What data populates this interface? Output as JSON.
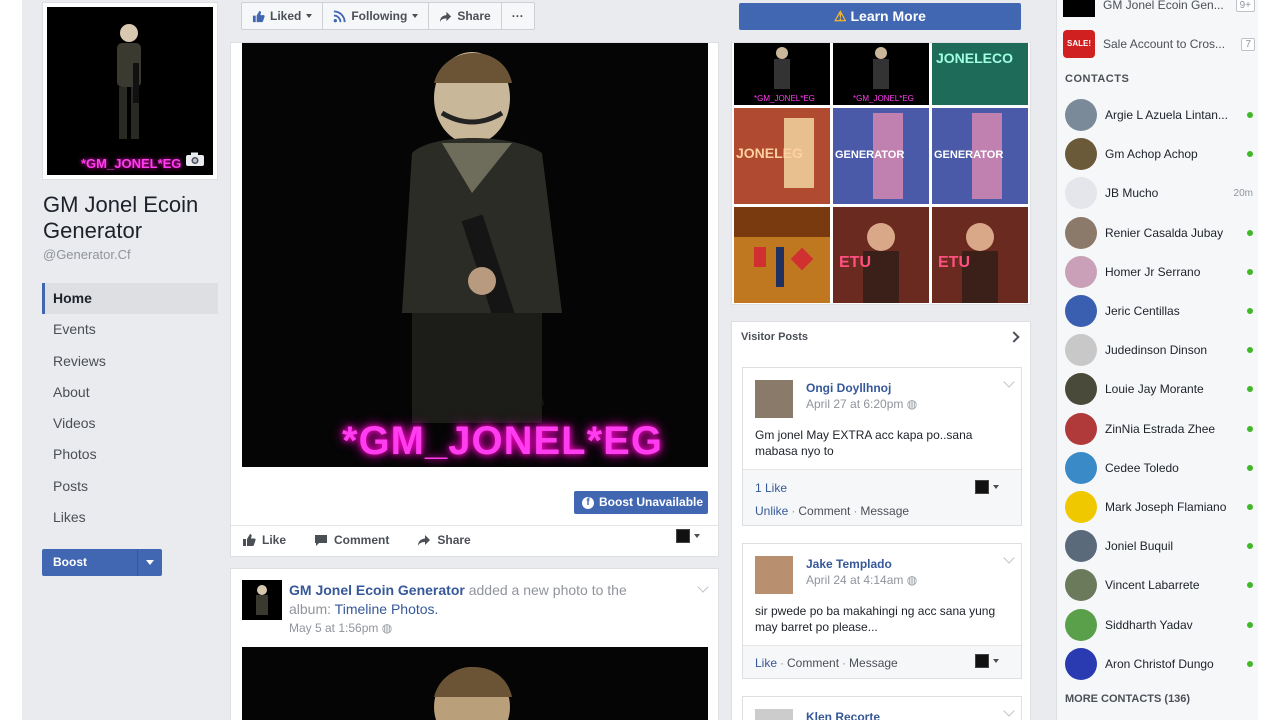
{
  "page": {
    "name": "GM Jonel Ecoin Generator",
    "handle": "@Generator.Cf",
    "profile_caption": "*GM_JONEL*EG"
  },
  "nav": [
    {
      "label": "Home"
    },
    {
      "label": "Events"
    },
    {
      "label": "Reviews"
    },
    {
      "label": "About"
    },
    {
      "label": "Videos"
    },
    {
      "label": "Photos"
    },
    {
      "label": "Posts"
    },
    {
      "label": "Likes"
    }
  ],
  "boost_label": "Boost",
  "action_bar": {
    "liked": "Liked",
    "following": "Following",
    "share": "Share",
    "more": "···"
  },
  "learn_more": "Learn More",
  "post1": {
    "image_caption": "*GM_JONEL*EG",
    "boost_unavailable": "Boost Unavailable",
    "like": "Like",
    "comment": "Comment",
    "share": "Share"
  },
  "post2": {
    "author": "GM Jonel Ecoin Generator",
    "action": "added a new photo to the album:",
    "album": "Timeline Photos.",
    "time": "May 5 at 1:56pm"
  },
  "photo_tiles": [
    {
      "label": ""
    },
    {
      "label": "*GM_JONEL*EG"
    },
    {
      "label": "JONELECO"
    },
    {
      "label": "JONELEG"
    },
    {
      "label": "GENERATOR"
    },
    {
      "label": "GENERATOR"
    },
    {
      "label": ""
    },
    {
      "label": "ETU"
    },
    {
      "label": "ETU"
    }
  ],
  "visitor_posts": {
    "title": "Visitor Posts",
    "items": [
      {
        "name": "Ongi Doyllhnoj",
        "time": "April 27 at 6:20pm",
        "text": "Gm jonel May EXTRA acc kapa po..sana mabasa nyo to",
        "likes": "1 Like",
        "link1": "Unlike",
        "link2": "Comment",
        "link3": "Message"
      },
      {
        "name": "Jake Templado",
        "time": "April 24 at 4:14am",
        "text": "sir pwede po ba makahingi ng acc sana yung may barret po please...",
        "link1": "Like",
        "link2": "Comment",
        "link3": "Message"
      },
      {
        "name": "Klen Recorte"
      }
    ]
  },
  "chat": {
    "top_items": [
      {
        "label": "GM Jonel Ecoin Gen...",
        "badge": "9+"
      },
      {
        "label": "Sale Account to Cros...",
        "badge": "7"
      }
    ],
    "contacts_heading": "CONTACTS",
    "contacts": [
      {
        "name": "Argie L Azuela Lintan...",
        "status": "online",
        "color": "#7a8a99"
      },
      {
        "name": "Gm Achop Achop",
        "status": "online",
        "color": "#6b5a3a"
      },
      {
        "name": "JB Mucho",
        "status": "20m",
        "color": "#e4e6eb"
      },
      {
        "name": "Renier Casalda Jubay",
        "status": "online",
        "color": "#8b7a6a"
      },
      {
        "name": "Homer Jr Serrano",
        "status": "online",
        "color": "#c9a0b8"
      },
      {
        "name": "Jeric Centillas",
        "status": "online",
        "color": "#3a5fb0"
      },
      {
        "name": "Judedinson Dinson",
        "status": "online",
        "color": "#c8c8c8"
      },
      {
        "name": "Louie Jay Morante",
        "status": "online",
        "color": "#4a4a3a"
      },
      {
        "name": "ZinNia Estrada Zhee",
        "status": "online",
        "color": "#b03a3a"
      },
      {
        "name": "Cedee Toledo",
        "status": "online",
        "color": "#3a8ac8"
      },
      {
        "name": "Mark Joseph Flamiano",
        "status": "online",
        "color": "#f0c800"
      },
      {
        "name": "Joniel Buquil",
        "status": "online",
        "color": "#5a6a7a"
      },
      {
        "name": "Vincent Labarrete",
        "status": "online",
        "color": "#6a7a5a"
      },
      {
        "name": "Siddharth Yadav",
        "status": "online",
        "color": "#5aa04a"
      },
      {
        "name": "Aron Christof Dungo",
        "status": "online",
        "color": "#2a3ab0"
      }
    ],
    "more_contacts": "MORE CONTACTS (136)"
  },
  "colors": {
    "brand_blue": "#4267b2",
    "online_green": "#42b72a",
    "neon_pink": "#ff3df0"
  }
}
